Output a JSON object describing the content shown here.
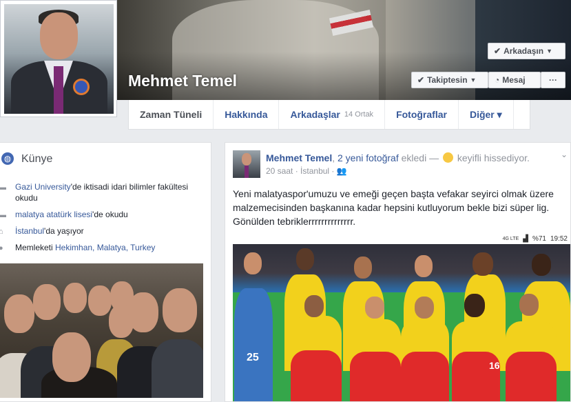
{
  "profile": {
    "name": "Mehmet Temel"
  },
  "cover_buttons": {
    "friends": "Arkadaşın",
    "following": "Takiptesin",
    "message": "Mesaj",
    "more": "···"
  },
  "nav": {
    "tabs": [
      {
        "label": "Zaman Tüneli",
        "sub": ""
      },
      {
        "label": "Hakkında",
        "sub": ""
      },
      {
        "label": "Arkadaşlar",
        "sub": "14 Ortak"
      },
      {
        "label": "Fotoğraflar",
        "sub": ""
      },
      {
        "label": "Diğer ▾",
        "sub": ""
      }
    ]
  },
  "intro": {
    "title": "Künye",
    "items": [
      {
        "link": "Gazi University",
        "rest": "'de iktisadi idari bilimler fakültesi okudu",
        "icon": "school-icon"
      },
      {
        "link": "malatya atatürk lisesi",
        "rest": "'de okudu",
        "icon": "school-icon"
      },
      {
        "link": "İstanbul",
        "rest": "'da yaşıyor",
        "icon": "home-icon"
      },
      {
        "prefix": "Memleketi ",
        "link": "Hekimhan, Malatya, Turkey",
        "icon": "location-icon"
      }
    ]
  },
  "post": {
    "author": "Mehmet Temel",
    "sep": ", ",
    "photos_link": "2 yeni fotoğraf",
    "action": " ekledi — ",
    "feeling": " keyifli hissediyor.",
    "time": "20 saat",
    "dot": " · ",
    "location": "İstanbul",
    "dot2": " · ",
    "audience_icon": "friends-icon",
    "text": "Yeni malatyaspor'umuzu ve emeği geçen başta vefakar seyirci olmak üzere malzemecisinden başkanına kadar hepsini kutluyorum bekle bizi süper lig. Gönülden tebriklerrrrrrrrrrrrrr.",
    "status_battery": "%71",
    "status_time": "19:52",
    "status_net": "4G LTE",
    "jersey_numbers": [
      "25",
      "16"
    ]
  },
  "colors": {
    "link": "#365899",
    "fb_blue": "#4267b2",
    "team_yellow": "#f2d11c",
    "team_red": "#e02a2a"
  }
}
